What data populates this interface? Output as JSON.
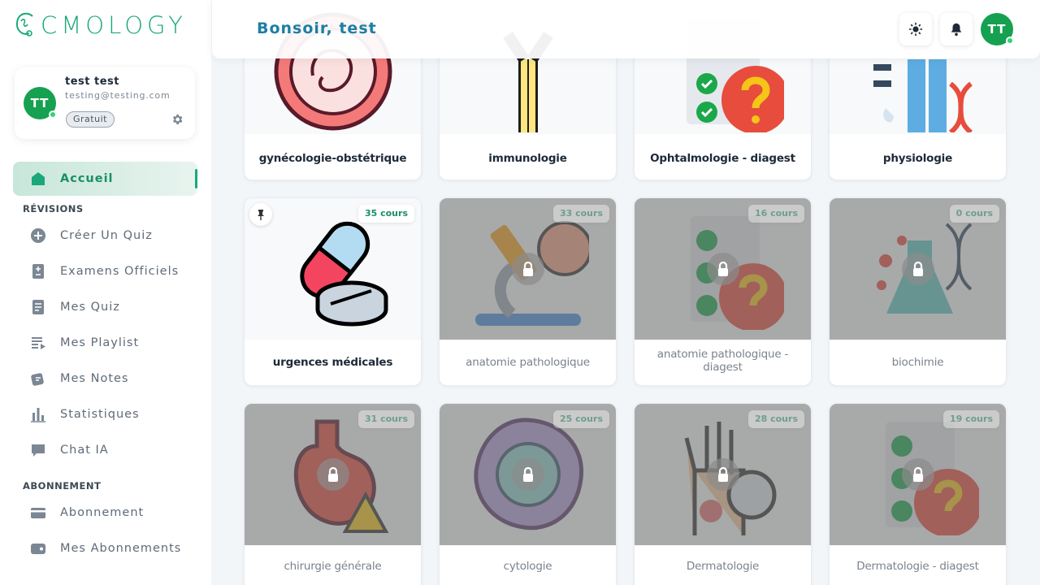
{
  "brand": {
    "logo_text": "CMOLOGY",
    "accent": "#1aa87a",
    "avatar_color": "#15a150"
  },
  "profile": {
    "initials": "TT",
    "name": "test test",
    "email": "testing@testing.com",
    "plan_badge": "Gratuit",
    "settings_icon": "gear-icon"
  },
  "nav": {
    "home": {
      "label": "Accueil",
      "icon": "home-icon"
    },
    "section_revisions": "RÉVISIONS",
    "revisions": [
      {
        "label": "Créer Un Quiz",
        "icon": "plus-circle-icon"
      },
      {
        "label": "Examens Officiels",
        "icon": "exam-sheet-icon"
      },
      {
        "label": "Mes Quiz",
        "icon": "document-icon"
      },
      {
        "label": "Mes Playlist",
        "icon": "playlist-icon"
      },
      {
        "label": "Mes Notes",
        "icon": "notes-icon"
      },
      {
        "label": "Statistiques",
        "icon": "bar-chart-icon"
      },
      {
        "label": "Chat IA",
        "icon": "chat-icon"
      }
    ],
    "section_subscription": "ABONNEMENT",
    "subscription": [
      {
        "label": "Abonnement",
        "icon": "credit-card-icon"
      },
      {
        "label": "Mes Abonnements",
        "icon": "wallet-icon"
      }
    ]
  },
  "header": {
    "greeting": "Bonsoir, test",
    "initials": "TT",
    "theme_icon": "sun-icon",
    "notification_icon": "bell-icon"
  },
  "cards_top": [
    {
      "title": "gynécologie-obstétrique",
      "icon": "uterus-icon"
    },
    {
      "title": "immunologie",
      "icon": "antibody-icon"
    },
    {
      "title": "Ophtalmologie - diagest",
      "icon": "checklist-question-icon"
    },
    {
      "title": "physiologie",
      "icon": "body-dna-icon"
    }
  ],
  "cards_row2": [
    {
      "title": "urgences médicales",
      "count": "35 cours",
      "icon": "pills-icon",
      "locked": false,
      "pinned": true
    },
    {
      "title": "anatomie pathologique",
      "count": "33 cours",
      "icon": "microscope-icon",
      "locked": true
    },
    {
      "title": "anatomie pathologique - diagest",
      "count": "16 cours",
      "icon": "checklist-question-icon",
      "locked": true
    },
    {
      "title": "biochimie",
      "count": "0 cours",
      "icon": "flask-dna-icon",
      "locked": true
    }
  ],
  "cards_row3": [
    {
      "title": "chirurgie générale",
      "count": "31 cours",
      "icon": "stomach-warning-icon",
      "locked": true
    },
    {
      "title": "cytologie",
      "count": "25 cours",
      "icon": "cell-icon",
      "locked": true
    },
    {
      "title": "Dermatologie",
      "count": "28 cours",
      "icon": "hand-skin-icon",
      "locked": true
    },
    {
      "title": "Dermatologie - diagest",
      "count": "19 cours",
      "icon": "checklist-question-icon",
      "locked": true
    }
  ]
}
